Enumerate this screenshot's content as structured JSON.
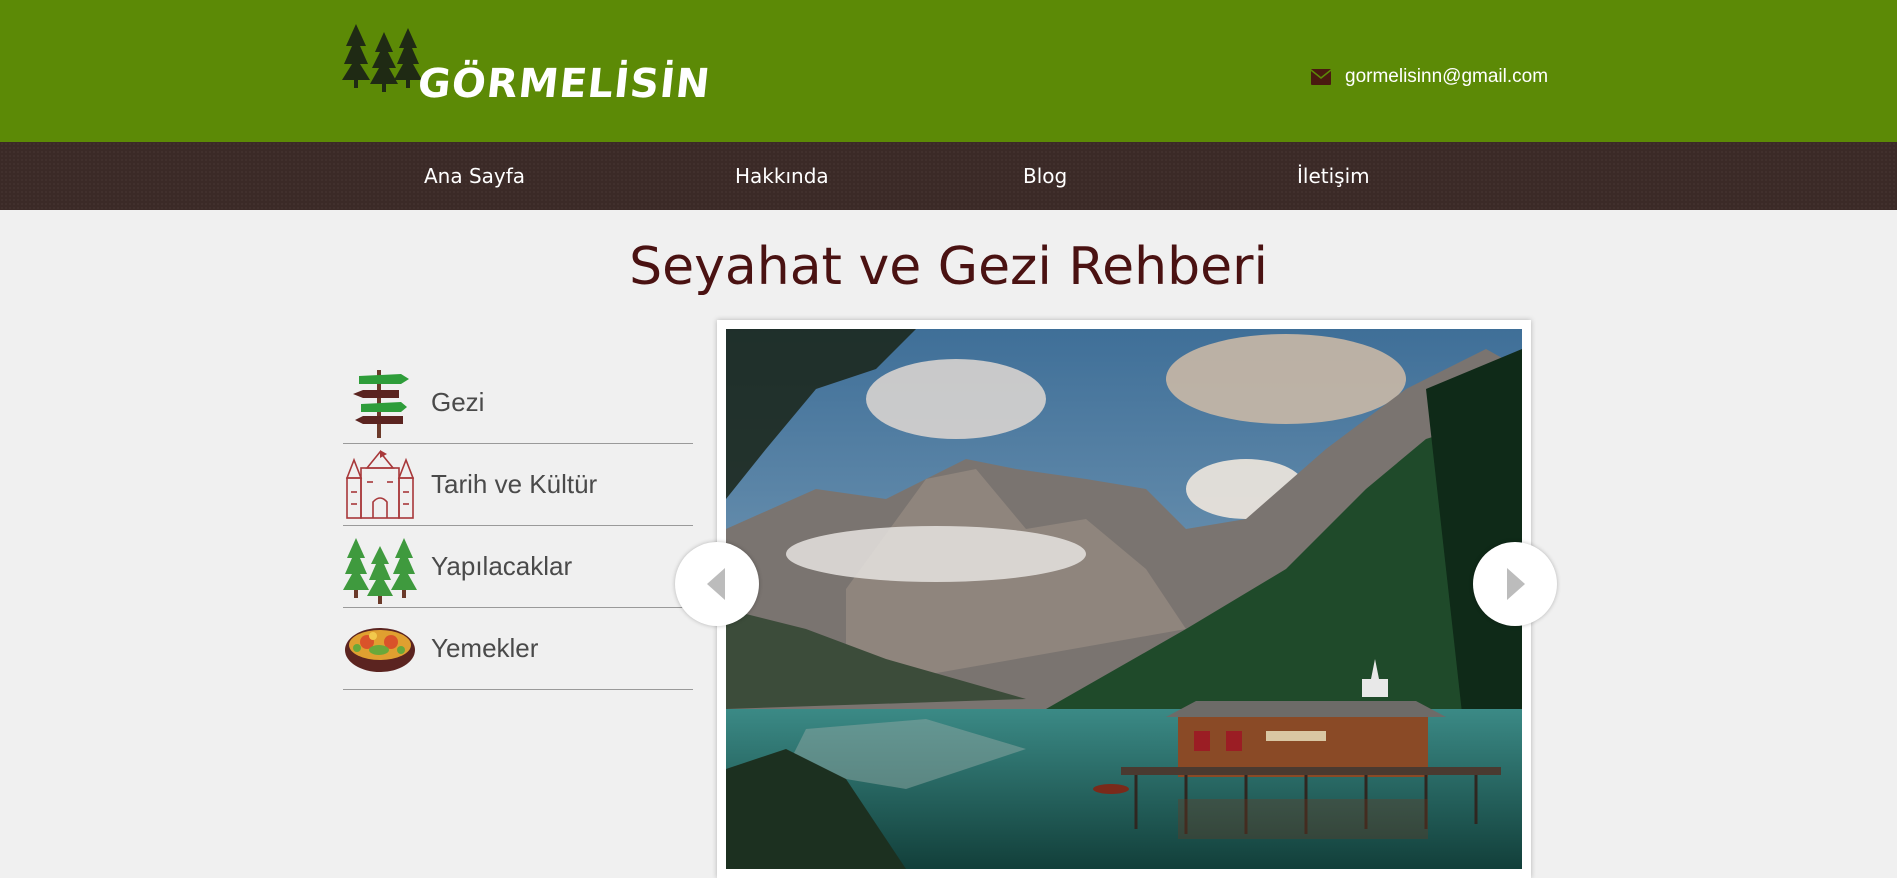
{
  "header": {
    "logo_text": "GÖRMELİSİN",
    "email": "gormelisinn@gmail.com",
    "bg_color": "#5c8a06",
    "icons": {
      "logo": "pine-trees-logo-icon",
      "mail": "envelope-icon"
    }
  },
  "nav": {
    "items": [
      {
        "label": "Ana Sayfa"
      },
      {
        "label": "Hakkında"
      },
      {
        "label": "Blog"
      },
      {
        "label": "İletişim"
      }
    ],
    "bg_color": "#3b2a27"
  },
  "main": {
    "title": "Seyahat ve Gezi Rehberi",
    "title_color": "#4a1212"
  },
  "sidebar": {
    "items": [
      {
        "label": "Gezi",
        "icon": "signpost-icon"
      },
      {
        "label": "Tarih ve Kültür",
        "icon": "castle-icon"
      },
      {
        "label": "Yapılacaklar",
        "icon": "trees-icon"
      },
      {
        "label": "Yemekler",
        "icon": "food-bowl-icon"
      }
    ]
  },
  "slider": {
    "image": "mountain-lake-cabin-photo",
    "prev_icon": "chevron-left-icon",
    "next_icon": "chevron-right-icon"
  }
}
